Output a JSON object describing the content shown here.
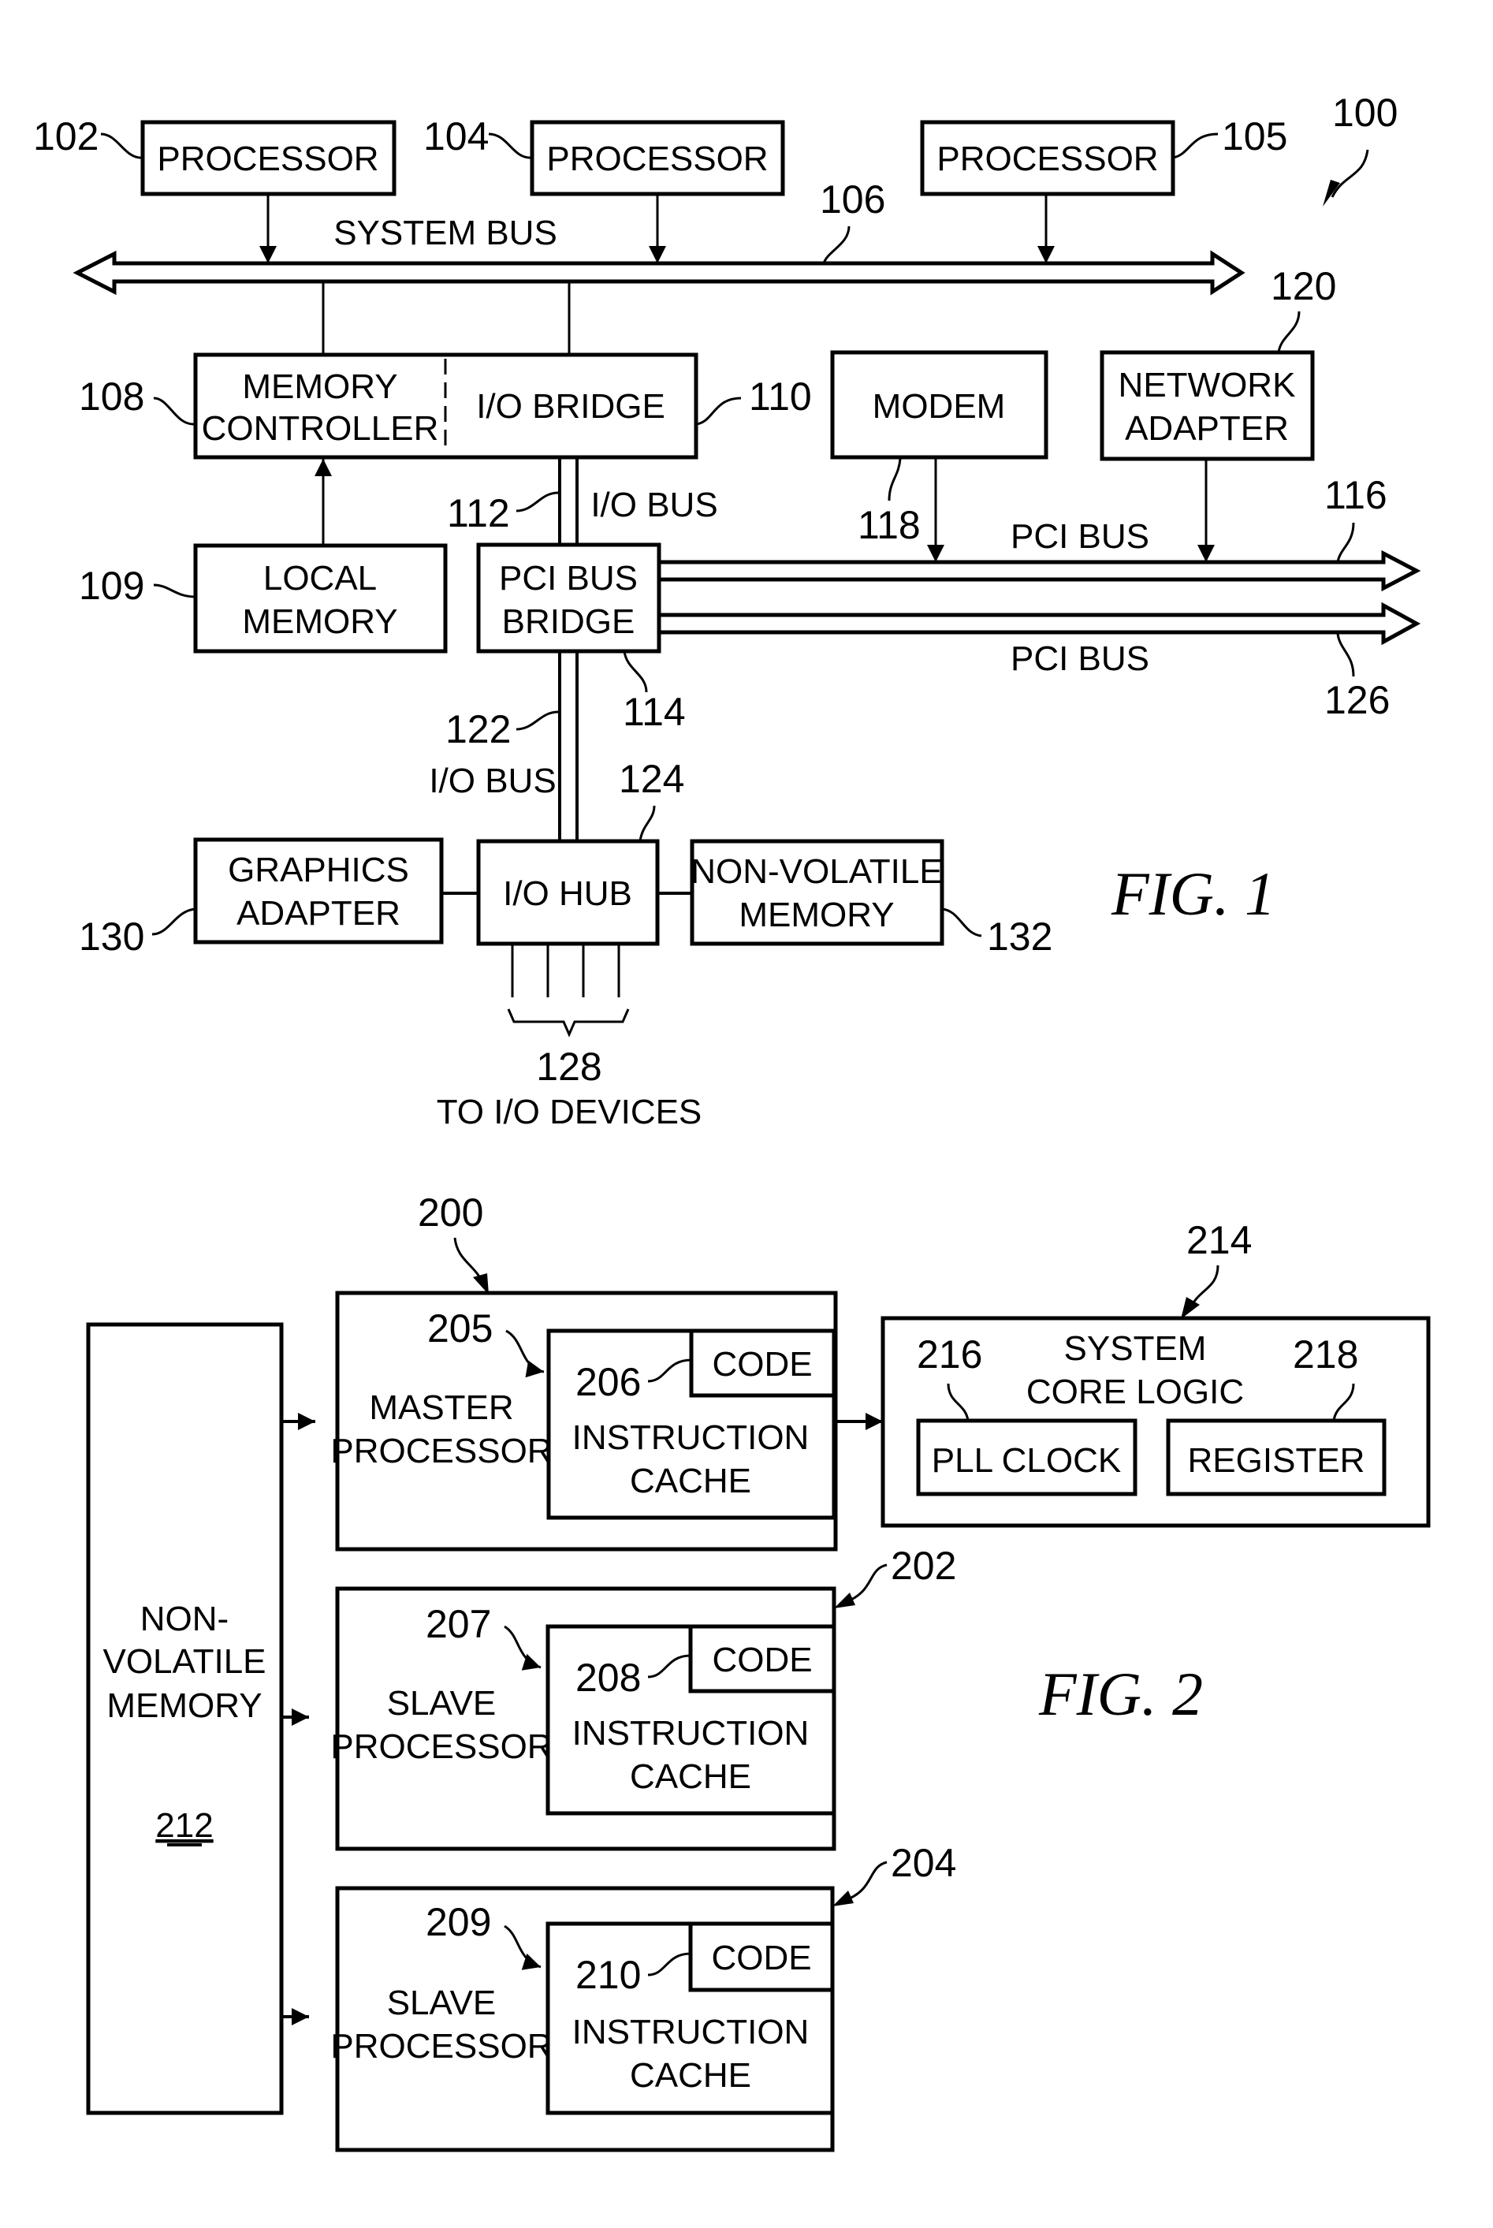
{
  "fig1": {
    "caption": "FIG. 1",
    "overall_ref": "100",
    "processors": [
      {
        "ref": "102",
        "label": "PROCESSOR"
      },
      {
        "ref": "104",
        "label": "PROCESSOR"
      },
      {
        "ref": "105",
        "label": "PROCESSOR"
      }
    ],
    "system_bus": {
      "label": "SYSTEM BUS",
      "ref": "106"
    },
    "memory_controller": {
      "ref": "108",
      "line1": "MEMORY",
      "line2": "CONTROLLER"
    },
    "io_bridge": {
      "ref": "110",
      "label": "I/O BRIDGE"
    },
    "local_memory": {
      "ref": "109",
      "line1": "LOCAL",
      "line2": "MEMORY"
    },
    "io_bus_upper": {
      "ref": "112",
      "label": "I/O BUS"
    },
    "pci_bus_bridge": {
      "ref": "114",
      "line1": "PCI BUS",
      "line2": "BRIDGE"
    },
    "modem": {
      "ref": "118",
      "label": "MODEM"
    },
    "network_adapter": {
      "ref": "120",
      "line1": "NETWORK",
      "line2": "ADAPTER"
    },
    "pci_bus_upper": {
      "ref": "116",
      "label": "PCI BUS"
    },
    "pci_bus_lower": {
      "ref": "126",
      "label": "PCI BUS"
    },
    "io_bus_lower": {
      "ref": "122",
      "label": "I/O BUS"
    },
    "io_hub": {
      "ref": "124",
      "label": "I/O HUB"
    },
    "graphics_adapter": {
      "ref": "130",
      "line1": "GRAPHICS",
      "line2": "ADAPTER"
    },
    "non_volatile_memory": {
      "ref": "132",
      "line1": "NON-VOLATILE",
      "line2": "MEMORY"
    },
    "io_devices": {
      "ref": "128",
      "label": "TO I/O DEVICES"
    }
  },
  "fig2": {
    "caption": "FIG. 2",
    "non_volatile_memory": {
      "line1": "NON-",
      "line2": "VOLATILE",
      "line3": "MEMORY",
      "ref": "212"
    },
    "master": {
      "group_ref": "200",
      "proc_ref": "205",
      "line1": "MASTER",
      "line2": "PROCESSOR",
      "cache_ref": "206",
      "cache_line1": "INSTRUCTION",
      "cache_line2": "CACHE",
      "code": "CODE"
    },
    "slave1": {
      "group_ref": "202",
      "proc_ref": "207",
      "line1": "SLAVE",
      "line2": "PROCESSOR",
      "cache_ref": "208",
      "cache_line1": "INSTRUCTION",
      "cache_line2": "CACHE",
      "code": "CODE"
    },
    "slave2": {
      "group_ref": "204",
      "proc_ref": "209",
      "line1": "SLAVE",
      "line2": "PROCESSOR",
      "cache_ref": "210",
      "cache_line1": "INSTRUCTION",
      "cache_line2": "CACHE",
      "code": "CODE"
    },
    "core_logic": {
      "ref": "214",
      "line1": "SYSTEM",
      "line2": "CORE LOGIC"
    },
    "pll_clock": {
      "ref": "216",
      "label": "PLL CLOCK"
    },
    "register": {
      "ref": "218",
      "label": "REGISTER"
    }
  }
}
